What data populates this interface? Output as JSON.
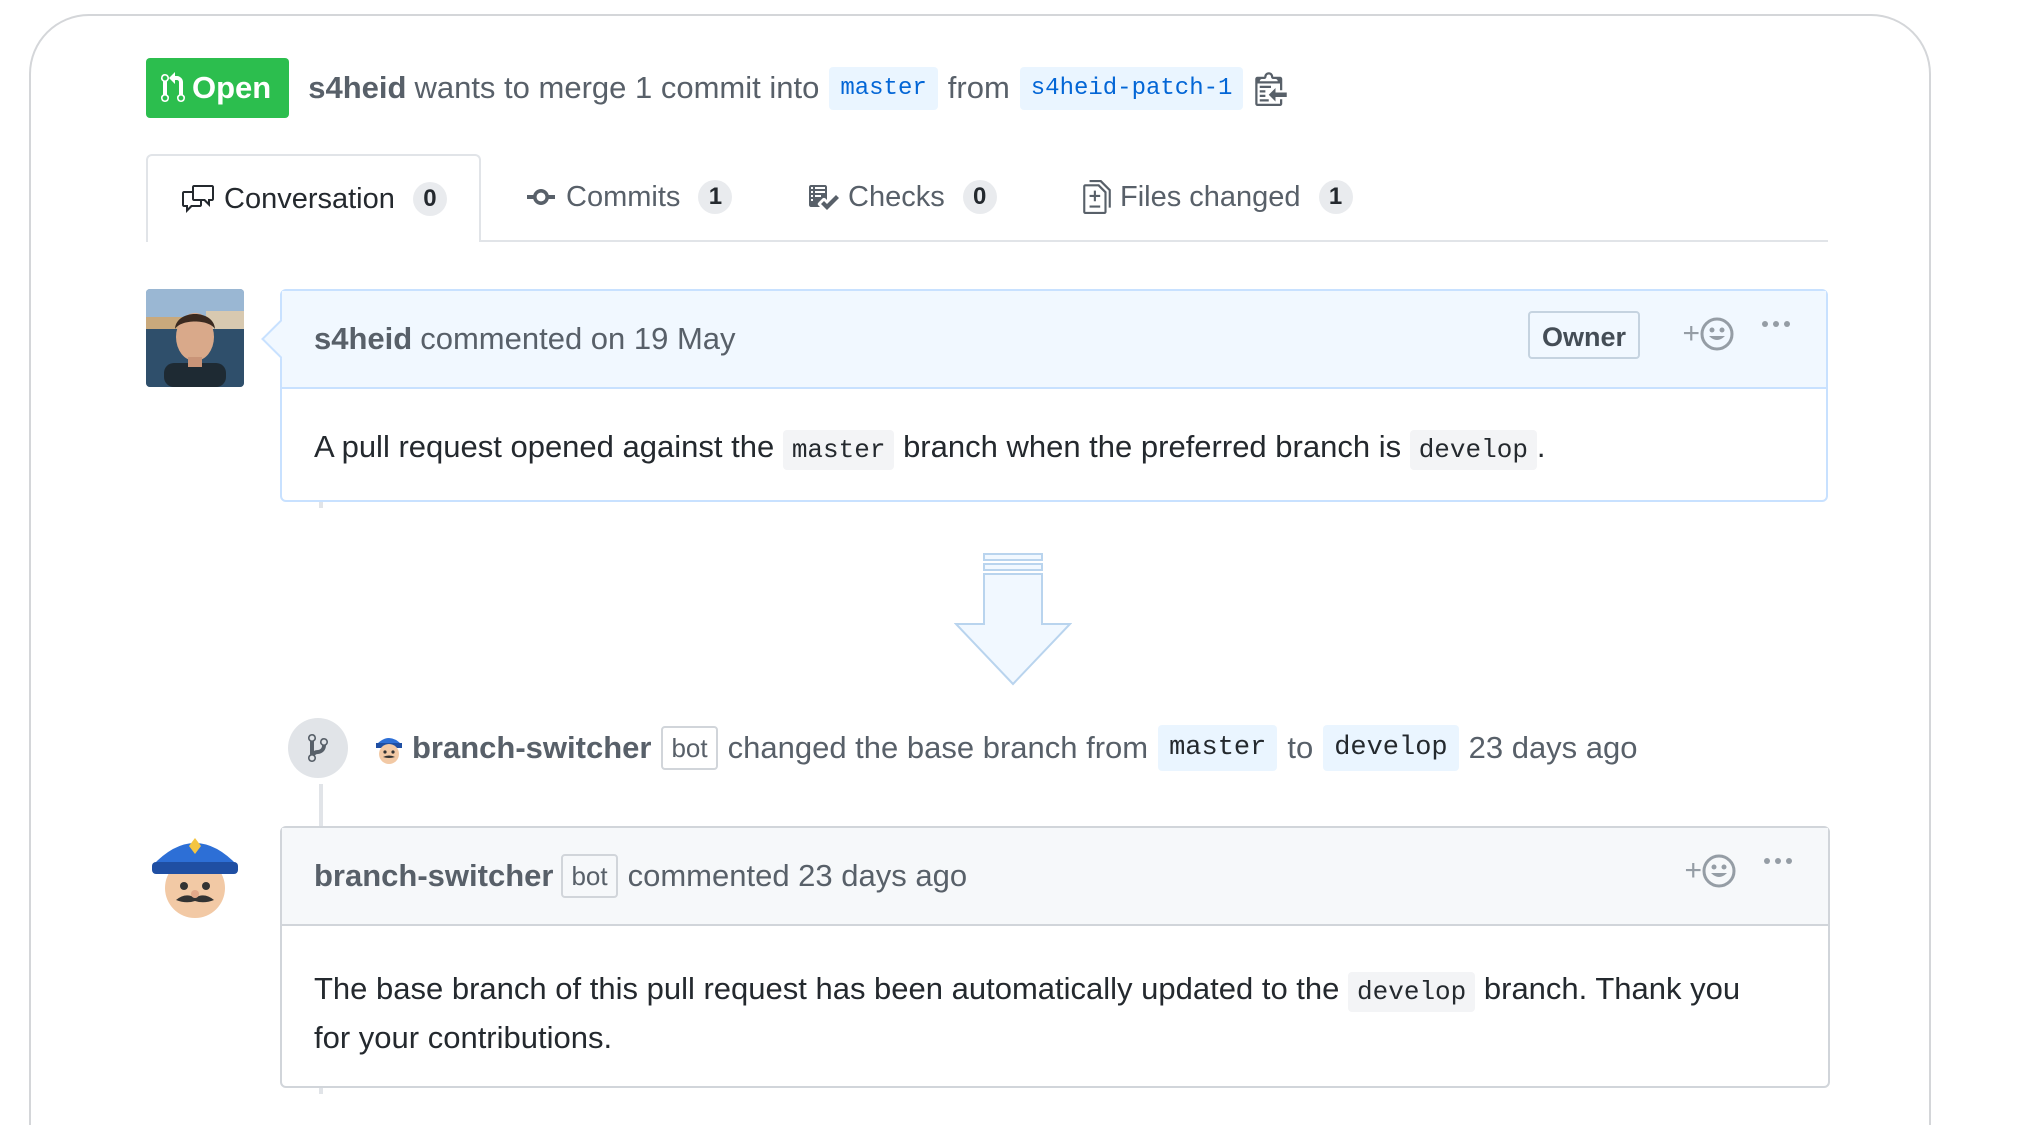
{
  "header": {
    "state_label": "Open",
    "author": "s4heid",
    "merge_text": "wants to merge 1 commit into",
    "base_branch": "master",
    "from_text": "from",
    "head_branch": "s4heid-patch-1"
  },
  "tabs": [
    {
      "label": "Conversation",
      "count": "0"
    },
    {
      "label": "Commits",
      "count": "1"
    },
    {
      "label": "Checks",
      "count": "0"
    },
    {
      "label": "Files changed",
      "count": "1"
    }
  ],
  "comment1": {
    "author": "s4heid",
    "meta": "commented on 19 May",
    "owner_label": "Owner",
    "reaction_plus": "+",
    "body_before": "A pull request opened against the",
    "code1": "master",
    "body_middle": "branch when the preferred branch is",
    "code2": "develop",
    "body_after": "."
  },
  "event": {
    "author": "branch-switcher",
    "bot_label": "bot",
    "text": "changed the base branch from",
    "from_branch": "master",
    "to_text": "to",
    "to_branch": "develop",
    "time": "23 days ago"
  },
  "comment2": {
    "author": "branch-switcher",
    "bot_label": "bot",
    "meta": "commented 23 days ago",
    "reaction_plus": "+",
    "body_before": "The base branch of this pull request has been automatically updated to the",
    "code": "develop",
    "body_after": "branch. Thank you",
    "body_line2": "for your contributions."
  },
  "colors": {
    "open_green": "#2cbe4e",
    "link_blue": "#0366d6",
    "owner_border": "#c8e1ff"
  }
}
